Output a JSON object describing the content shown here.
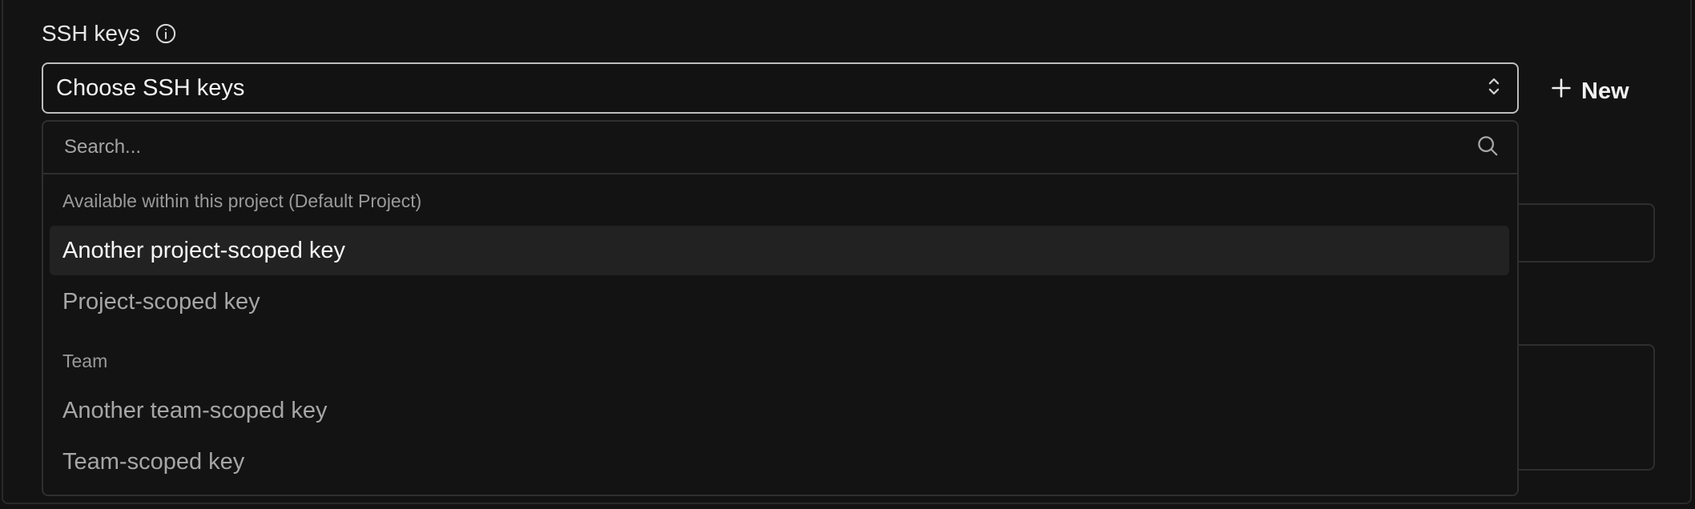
{
  "field": {
    "label": "SSH keys",
    "info_icon": "info-circle-icon"
  },
  "select": {
    "value": "Choose SSH keys",
    "chevron_icon": "chevron-up-down-icon"
  },
  "new_button": {
    "icon": "plus-icon",
    "label": "New"
  },
  "dropdown": {
    "search": {
      "placeholder": "Search...",
      "icon": "search-icon"
    },
    "groups": [
      {
        "label": "Available within this project (Default Project)",
        "items": [
          {
            "label": "Another project-scoped key",
            "highlighted": true
          },
          {
            "label": "Project-scoped key",
            "highlighted": false
          }
        ]
      },
      {
        "label": "Team",
        "items": [
          {
            "label": "Another team-scoped key",
            "highlighted": false
          },
          {
            "label": "Team-scoped key",
            "highlighted": false
          }
        ]
      }
    ]
  },
  "colors": {
    "background": "#131313",
    "text": "#ececec",
    "muted": "#a6a6a6",
    "highlight": "#222222",
    "border": "#bdbdbd"
  }
}
